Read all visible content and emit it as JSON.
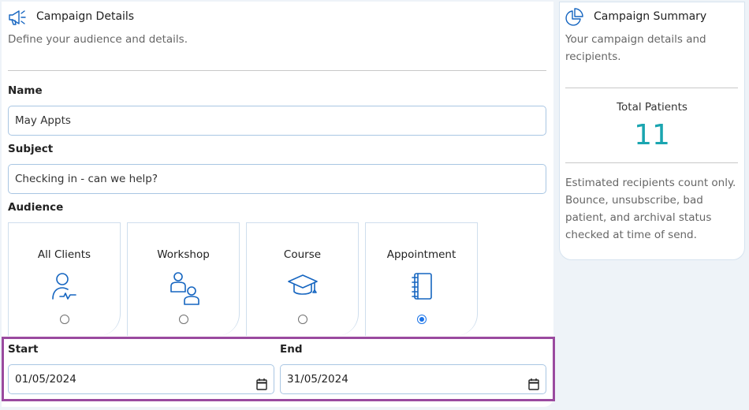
{
  "details": {
    "title": "Campaign Details",
    "subtitle": "Define your audience and details.",
    "icon": "megaphone-icon"
  },
  "form": {
    "name_label": "Name",
    "name_value": "May Appts",
    "subject_label": "Subject",
    "subject_value": "Checking in - can we help?",
    "audience_label": "Audience"
  },
  "audience": {
    "options": [
      {
        "label": "All Clients",
        "icon": "person-pulse-icon",
        "selected": false
      },
      {
        "label": "Workshop",
        "icon": "group-icon",
        "selected": false
      },
      {
        "label": "Course",
        "icon": "graduation-cap-icon",
        "selected": false
      },
      {
        "label": "Appointment",
        "icon": "notebook-icon",
        "selected": true
      }
    ]
  },
  "dates": {
    "start_label": "Start",
    "start_value": "01/05/2024",
    "end_label": "End",
    "end_value": "31/05/2024"
  },
  "summary": {
    "title": "Campaign Summary",
    "subtitle": "Your campaign details and recipients.",
    "icon": "pie-chart-icon",
    "total_label": "Total Patients",
    "total_value": "11",
    "note": "Estimated recipients count only. Bounce, unsubscribe, bad patient, and archival status checked at time of send."
  },
  "colors": {
    "accent": "#1a73e8",
    "icon_blue": "#1565c0",
    "total_teal": "#1aa5b0",
    "highlight_border": "#9a4a9f"
  }
}
